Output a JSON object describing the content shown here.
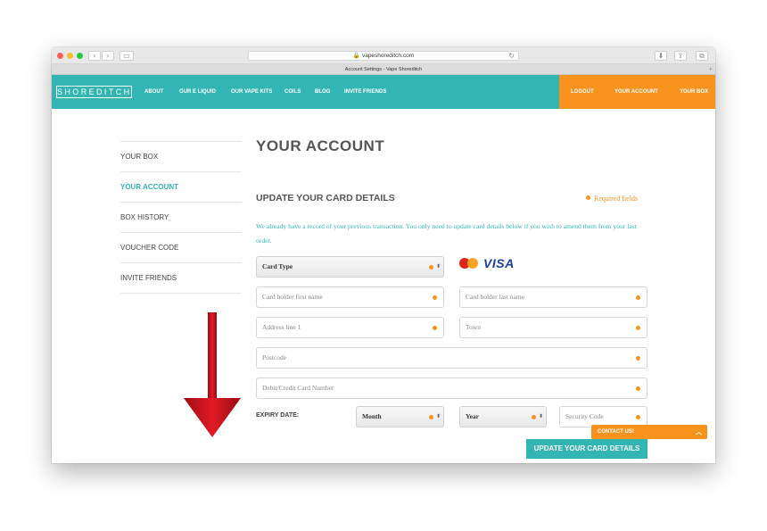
{
  "browser": {
    "url": "vapeshoreditch.com",
    "tab_title": "Account Settings - Vape Shoreditch",
    "back_icon": "chevron-left-icon",
    "forward_icon": "chevron-right-icon"
  },
  "header": {
    "logo": "SHOREDITCH",
    "nav": [
      "ABOUT",
      "OUR E LIQUID",
      "OUR VAPE KITS",
      "COILS",
      "BLOG",
      "INVITE FRIENDS"
    ],
    "right_nav": [
      "LOGOUT",
      "YOUR ACCOUNT",
      "YOUR BOX"
    ]
  },
  "sidebar": {
    "items": [
      {
        "label": "YOUR BOX"
      },
      {
        "label": "YOUR ACCOUNT"
      },
      {
        "label": "BOX HISTORY"
      },
      {
        "label": "VOUCHER CODE"
      },
      {
        "label": "INVITE FRIENDS"
      }
    ]
  },
  "main": {
    "title": "YOUR ACCOUNT",
    "section_title": "UPDATE YOUR CARD DETAILS",
    "required_label": "Required fields",
    "info_text": "We already have a record of your previous transaction. You only need to update card details below if you wish to amend them from your last order.",
    "card_type": "Card Type",
    "visa_label": "VISA",
    "fields": {
      "first_name": "Card holder first name",
      "last_name": "Card holder last name",
      "address": "Address line 1",
      "town": "Town",
      "postcode": "Postcode",
      "card_number": "Debit/Credit Card Number",
      "security_code": "Security Code"
    },
    "expiry_label": "EXPIRY DATE:",
    "month": "Month",
    "year": "Year",
    "submit": "UPDATE YOUR CARD DETAILS"
  },
  "contact_tab": "CONTACT US!",
  "colors": {
    "teal": "#33b6b3",
    "orange": "#f7931d",
    "arrow_red": "#c8101e"
  }
}
